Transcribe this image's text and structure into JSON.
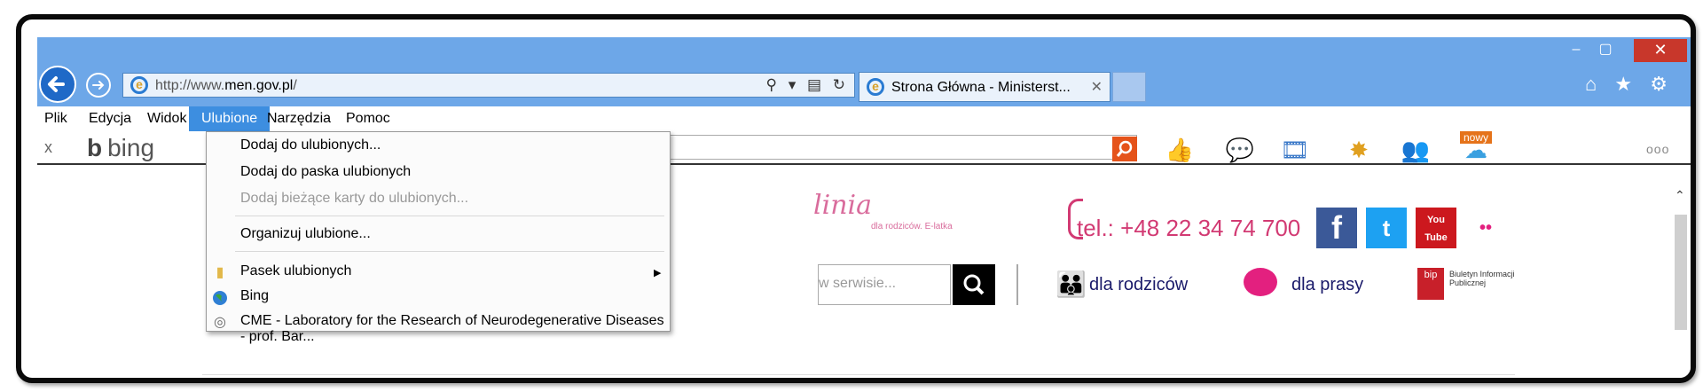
{
  "browser": {
    "address_url_prefix": "http://www.",
    "address_url_host": "men.gov.pl",
    "address_url_suffix": "/",
    "tab_title": "Strona Główna - Ministerst...",
    "tab_close": "✕",
    "window_controls": {
      "minimize": "–",
      "maximize": "▢",
      "close": "✕"
    },
    "nav_icons": {
      "back": "←",
      "forward": "→",
      "search": "⚲ ▾",
      "compat": "▤ ↻"
    },
    "right_icons": {
      "home": "⌂",
      "favorites": "★",
      "tools": "⚙"
    }
  },
  "menubar": {
    "items": [
      "Plik",
      "Edycja",
      "Widok",
      "Ulubione",
      "Narzędzia",
      "Pomoc"
    ],
    "active": "Ulubione"
  },
  "bing_toolbar": {
    "close": "x",
    "logo": "bing",
    "badge": "nowy",
    "overflow": "ooo"
  },
  "favorites_menu": {
    "items": [
      {
        "label": "Dodaj do ulubionych...",
        "disabled": false
      },
      {
        "label": "Dodaj do paska ulubionych",
        "disabled": false
      },
      {
        "label": "Dodaj bieżące karty do ulubionych...",
        "disabled": true
      },
      {
        "label": "Organizuj ulubione...",
        "disabled": false
      },
      {
        "label": "Pasek ulubionych",
        "disabled": false,
        "submenu": true,
        "icon": "folder-icon"
      },
      {
        "label": "Bing",
        "disabled": false,
        "icon": "globe-icon"
      },
      {
        "label": "CME - Laboratory for the Research of Neurodegenerative Diseases - prof. Bar...",
        "disabled": false,
        "icon": "page-icon"
      }
    ]
  },
  "page": {
    "linia_logo": "linia",
    "linia_sub": "dla rodziców. E-latka",
    "phone": "tel.: +48 22 34 74 700",
    "search_placeholder": "w serwisie...",
    "nav_parents": "dla rodziców",
    "nav_press": "dla prasy",
    "bip_text": "Biuletyn Informacji Publicznej",
    "bip_logo": "bip",
    "social": {
      "facebook": "f",
      "twitter": "t",
      "youtube": "You Tube",
      "flickr": "••"
    }
  },
  "colors": {
    "titlebar": "#6da7e8",
    "menu_active": "#3d8ee0",
    "close_button": "#c8372b",
    "bing_go": "#e5531a",
    "linia_pink": "#d96c9c",
    "phone_pink": "#d23a73",
    "facebook": "#3b5998",
    "twitter": "#1da1f2",
    "youtube": "#cc181e"
  }
}
